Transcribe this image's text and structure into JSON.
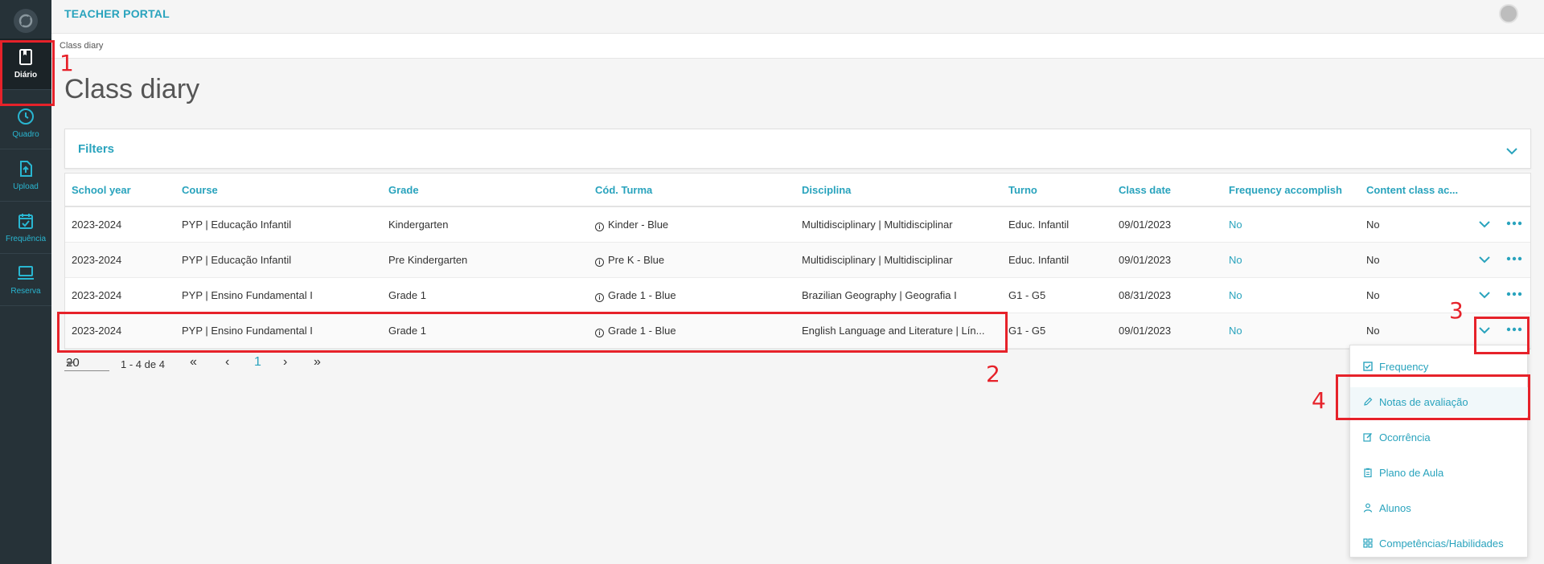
{
  "app": {
    "title": "TEACHER PORTAL"
  },
  "breadcrumb": "Class diary",
  "page_title": "Class diary",
  "sidebar": {
    "items": [
      {
        "label": "Diário",
        "icon": "book-icon",
        "active": true
      },
      {
        "label": "Quadro",
        "icon": "clock-icon",
        "active": false
      },
      {
        "label": "Upload",
        "icon": "upload-icon",
        "active": false
      },
      {
        "label": "Frequência",
        "icon": "calendar-check-icon",
        "active": false
      },
      {
        "label": "Reserva",
        "icon": "laptop-icon",
        "active": false
      }
    ]
  },
  "filters": {
    "label": "Filters"
  },
  "table": {
    "headers": [
      "School year",
      "Course",
      "Grade",
      "Cód. Turma",
      "Disciplina",
      "Turno",
      "Class date",
      "Frequency accomplish",
      "Content class ac..."
    ],
    "rows": [
      [
        "2023-2024",
        "PYP | Educação Infantil",
        "Kindergarten",
        "Kinder - Blue",
        "Multidisciplinary | Multidisciplinar",
        "Educ. Infantil",
        "09/01/2023",
        "No",
        "No"
      ],
      [
        "2023-2024",
        "PYP | Educação Infantil",
        "Pre Kindergarten",
        "Pre K - Blue",
        "Multidisciplinary | Multidisciplinar",
        "Educ. Infantil",
        "09/01/2023",
        "No",
        "No"
      ],
      [
        "2023-2024",
        "PYP | Ensino Fundamental I",
        "Grade 1",
        "Grade 1 - Blue",
        "Brazilian Geography | Geografia I",
        "G1 - G5",
        "08/31/2023",
        "No",
        "No"
      ],
      [
        "2023-2024",
        "PYP | Ensino Fundamental I",
        "Grade 1",
        "Grade 1 - Blue",
        "English Language and Literature | Lín...",
        "G1 - G5",
        "09/01/2023",
        "No",
        "No"
      ]
    ]
  },
  "pagination": {
    "page_size": "20",
    "range": "1 - 4 de 4",
    "first": "«",
    "prev": "‹",
    "current": "1",
    "next": "›",
    "last": "»"
  },
  "menu": {
    "items": [
      {
        "label": "Frequency",
        "icon": "checkbox-icon"
      },
      {
        "label": "Notas de avaliação",
        "icon": "pencil-icon"
      },
      {
        "label": "Ocorrência",
        "icon": "edit-note-icon"
      },
      {
        "label": "Plano de Aula",
        "icon": "clipboard-icon"
      },
      {
        "label": "Alunos",
        "icon": "person-icon"
      },
      {
        "label": "Competências/Habilidades",
        "icon": "grid-icon"
      }
    ]
  },
  "annotations": [
    "1",
    "2",
    "3",
    "4"
  ],
  "colors": {
    "accent": "#29a3bd",
    "sidebar": "#263238",
    "annotation": "#e6222a"
  }
}
